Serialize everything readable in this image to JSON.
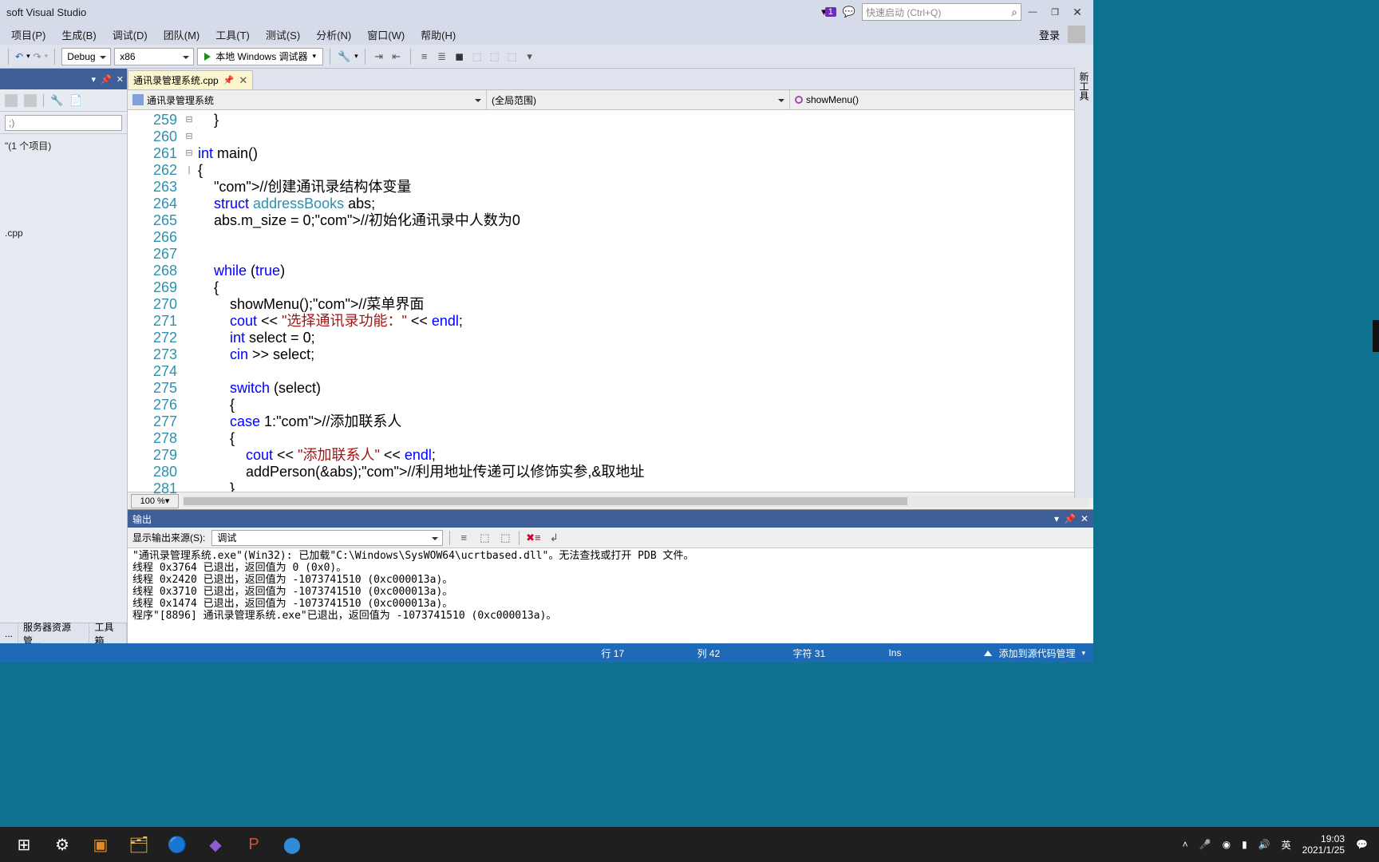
{
  "title": "soft Visual Studio",
  "notif_badge": "1",
  "quick_launch_placeholder": "快速启动 (Ctrl+Q)",
  "menus": [
    "项目(P)",
    "生成(B)",
    "调试(D)",
    "团队(M)",
    "工具(T)",
    "测试(S)",
    "分析(N)",
    "窗口(W)",
    "帮助(H)"
  ],
  "login": "登录",
  "toolbar": {
    "config": "Debug",
    "platform": "x86",
    "debugger": "本地 Windows 调试器"
  },
  "left": {
    "search_placeholder": ";)",
    "solution_suffix": "\"(1 个项目)",
    "file": ".cpp",
    "bottom_tabs": [
      "...",
      "服务器资源管...",
      "工具箱"
    ]
  },
  "tab": {
    "name": "通讯录管理系统.cpp"
  },
  "nav": {
    "project": "通讯录管理系统",
    "scope": "(全局范围)",
    "func": "showMenu()"
  },
  "code": {
    "start": 259,
    "lines": [
      "    }",
      "",
      "int main()",
      "{",
      "    //创建通讯录结构体变量",
      "    struct addressBooks abs;",
      "    abs.m_size = 0;//初始化通讯录中人数为0",
      "",
      "",
      "    while (true)",
      "    {",
      "        showMenu();//菜单界面",
      "        cout << \"选择通讯录功能：\" << endl;",
      "        int select = 0;",
      "        cin >> select;",
      "",
      "        switch (select)",
      "        {",
      "        case 1://添加联系人",
      "        {",
      "            cout << \"添加联系人\" << endl;",
      "            addPerson(&abs);//利用地址传递可以修饰实参,&取地址",
      "        }"
    ]
  },
  "zoom": "100 %",
  "output": {
    "title": "输出",
    "src_label": "显示输出来源(S):",
    "src_value": "调试",
    "lines": [
      "\"通讯录管理系统.exe\"(Win32): 已加载\"C:\\Windows\\SysWOW64\\ucrtbased.dll\"。无法查找或打开 PDB 文件。",
      "线程 0x3764 已退出，返回值为 0 (0x0)。",
      "线程 0x2420 已退出，返回值为 -1073741510 (0xc000013a)。",
      "线程 0x3710 已退出，返回值为 -1073741510 (0xc000013a)。",
      "线程 0x1474 已退出，返回值为 -1073741510 (0xc000013a)。",
      "程序\"[8896] 通讯录管理系统.exe\"已退出，返回值为 -1073741510 (0xc000013a)。"
    ]
  },
  "status": {
    "line": "行 17",
    "col": "列 42",
    "char": "字符 31",
    "ins": "Ins",
    "scc": "添加到源代码管理"
  },
  "rail": "新工具",
  "taskbar": {
    "ime": "英",
    "time": "19:03",
    "date": "2021/1/25"
  }
}
